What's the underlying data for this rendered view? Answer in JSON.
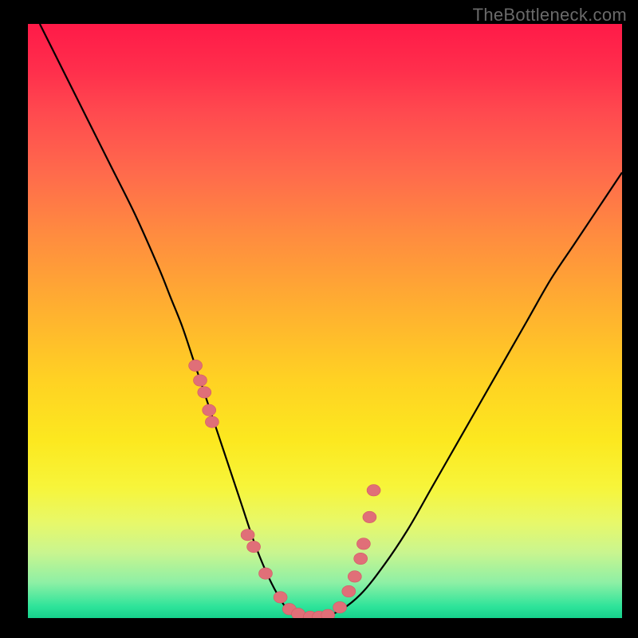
{
  "watermark": "TheBottleneck.com",
  "colors": {
    "background": "#000000",
    "curve": "#000000",
    "dot": "#e06f78"
  },
  "chart_data": {
    "type": "line",
    "title": "",
    "xlabel": "",
    "ylabel": "",
    "xlim": [
      0,
      100
    ],
    "ylim": [
      0,
      100
    ],
    "grid": false,
    "legend": false,
    "series": [
      {
        "name": "bottleneck-curve",
        "x": [
          2,
          6,
          10,
          14,
          18,
          22,
          24,
          26,
          28,
          30,
          32,
          34,
          36,
          38,
          40,
          42,
          44,
          46,
          48,
          52,
          56,
          60,
          64,
          68,
          72,
          76,
          80,
          84,
          88,
          92,
          96,
          100
        ],
        "y": [
          100,
          92,
          84,
          76,
          68,
          59,
          54,
          49,
          43,
          37,
          31,
          25,
          19,
          13,
          8,
          4,
          1,
          0,
          0,
          1,
          4,
          9,
          15,
          22,
          29,
          36,
          43,
          50,
          57,
          63,
          69,
          75
        ]
      }
    ],
    "markers": {
      "name": "highlighted-points",
      "x": [
        28.2,
        29.0,
        29.7,
        30.5,
        31.0,
        37.0,
        38.0,
        40.0,
        42.5,
        44.0,
        45.5,
        47.5,
        49.0,
        50.5,
        52.5,
        54.0,
        55.0,
        56.0,
        56.5,
        57.5,
        58.2
      ],
      "y": [
        42.5,
        40.0,
        38.0,
        35.0,
        33.0,
        14.0,
        12.0,
        7.5,
        3.5,
        1.5,
        0.7,
        0.2,
        0.2,
        0.5,
        1.8,
        4.5,
        7.0,
        10.0,
        12.5,
        17.0,
        21.5
      ]
    }
  }
}
